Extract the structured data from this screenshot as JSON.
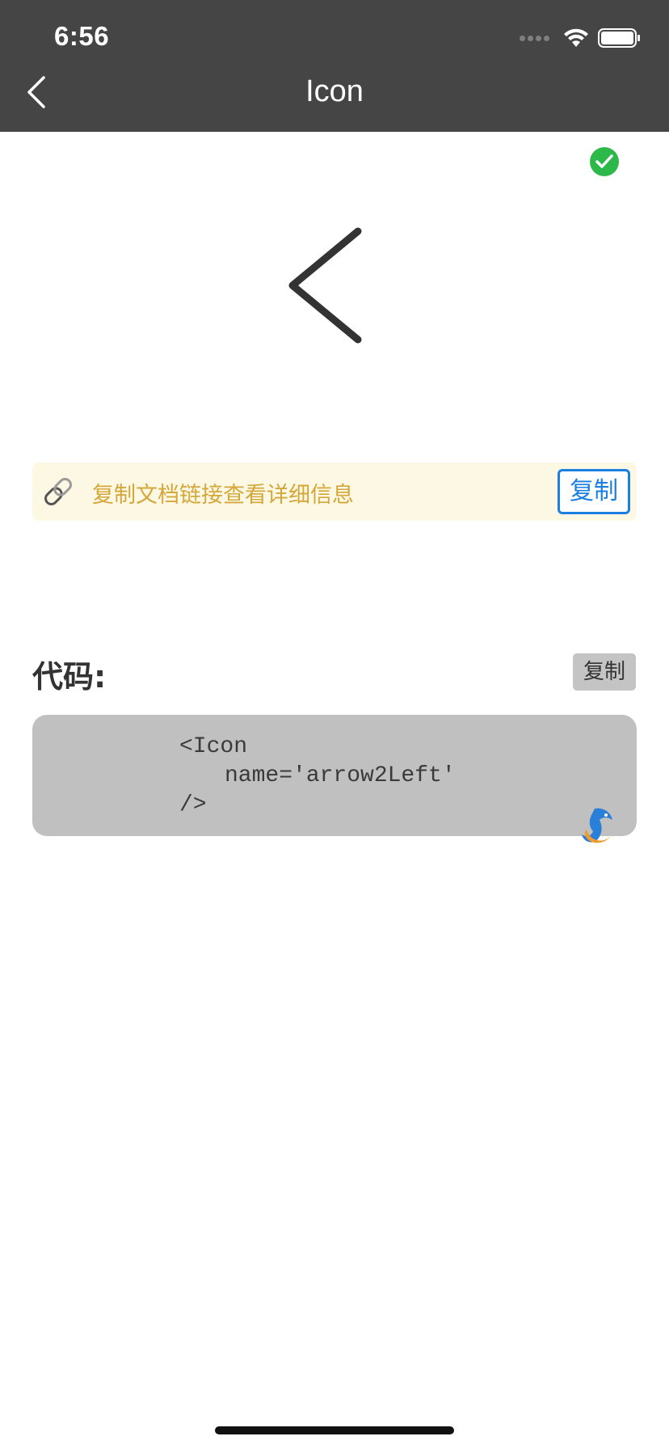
{
  "status_bar": {
    "time": "6:56"
  },
  "nav": {
    "title": "Icon",
    "back_icon": "chevron-left-icon"
  },
  "preview": {
    "icon_name": "arrow2Left",
    "selected": true
  },
  "tip": {
    "text": "复制文档链接查看详细信息",
    "copy_label": "复制",
    "icon": "link-icon"
  },
  "code": {
    "label": "代码:",
    "copy_label": "复制",
    "lines": [
      "<Icon",
      "name='arrow2Left'",
      "/>"
    ]
  },
  "colors": {
    "header_bg": "#454545",
    "tip_bg": "#fdf8e4",
    "tip_text": "#d4a73a",
    "accent_blue": "#1a7fe0",
    "check_green": "#2db84a",
    "code_bg": "#c0c0c0"
  }
}
